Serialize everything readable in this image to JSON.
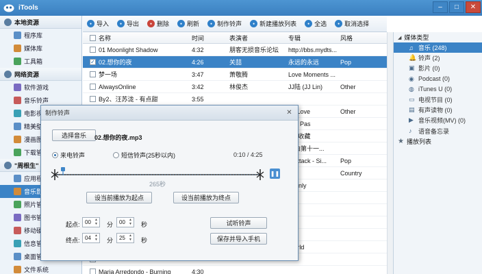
{
  "app": {
    "title": "iTools",
    "window_controls": [
      "minimize",
      "maximize",
      "close"
    ]
  },
  "sidebar": {
    "sections": [
      {
        "label": "本地资源",
        "items": [
          {
            "label": "程序库"
          },
          {
            "label": "媒体库"
          },
          {
            "label": "工具箱"
          }
        ]
      },
      {
        "label": "网络资源",
        "items": [
          {
            "label": "软件游戏"
          },
          {
            "label": "音乐铃声"
          },
          {
            "label": "电影视频"
          },
          {
            "label": "精美壁纸"
          },
          {
            "label": "漫画图书"
          },
          {
            "label": "下载管理"
          }
        ]
      },
      {
        "label": "\"周根生\"",
        "items": [
          {
            "label": "应用程序"
          },
          {
            "label": "音乐影视"
          },
          {
            "label": "照片管理"
          },
          {
            "label": "图书管理"
          },
          {
            "label": "移动硬盘"
          },
          {
            "label": "信息管理"
          },
          {
            "label": "桌面管理"
          },
          {
            "label": "文件系统"
          }
        ]
      }
    ],
    "selected": "音乐影视"
  },
  "toolbar": {
    "buttons": [
      {
        "label": "导入",
        "icon": "import-icon",
        "color": "#2f80c9"
      },
      {
        "label": "导出",
        "icon": "export-icon",
        "color": "#2f80c9"
      },
      {
        "label": "删除",
        "icon": "delete-icon",
        "color": "#c9453b"
      },
      {
        "label": "刷新",
        "icon": "refresh-icon",
        "color": "#2f80c9"
      },
      {
        "label": "制作铃声",
        "icon": "ringtone-icon",
        "color": "#2f80c9"
      },
      {
        "label": "新建播放列表",
        "icon": "playlist-icon",
        "color": "#2f80c9"
      },
      {
        "label": "全选",
        "icon": "select-all-icon",
        "color": "#2f80c9"
      },
      {
        "label": "取消选择",
        "icon": "deselect-icon",
        "color": "#2f80c9"
      }
    ]
  },
  "table": {
    "columns": [
      "名称",
      "时间",
      "表演者",
      "专辑",
      "风格"
    ],
    "rows": [
      {
        "name": "01 Moonlight Shadow",
        "time": "4:32",
        "artist": "朋客无损音乐论坛",
        "album": "http://bbs.mydts...",
        "genre": "",
        "checked": false,
        "selected": false
      },
      {
        "name": "02.想你的夜",
        "time": "4:26",
        "artist": "关喆",
        "album": "永远的永远",
        "genre": "Pop",
        "checked": true,
        "selected": true
      },
      {
        "name": "梦一场",
        "time": "3:47",
        "artist": "萧敬腾",
        "album": "Love Moments ...",
        "genre": "",
        "checked": false,
        "selected": false
      },
      {
        "name": "AlwaysOnline",
        "time": "3:42",
        "artist": "林俊杰",
        "album": "JJ陆 (JJ Lin)",
        "genre": "Other",
        "checked": false,
        "selected": false
      },
      {
        "name": "By2、汪苏泷 - 有点甜",
        "time": "3:55",
        "artist": "",
        "album": "",
        "genre": "",
        "checked": false,
        "selected": false
      },
      {
        "name": "",
        "time": "",
        "artist": "",
        "album": "ng Love",
        "genre": "Other",
        "checked": false,
        "selected": false
      },
      {
        "name": "",
        "time": "",
        "artist": "",
        "album": "mul Pas",
        "genre": "",
        "checked": false,
        "selected": false
      },
      {
        "name": "",
        "time": "",
        "artist": "",
        "album": "sen收藏",
        "genre": "",
        "checked": false,
        "selected": false
      },
      {
        "name": "",
        "time": "",
        "artist": "",
        "album": "金曲第十一...",
        "genre": "",
        "checked": false,
        "selected": false
      },
      {
        "name": "",
        "time": "",
        "artist": "",
        "album": "rt Attack - Si...",
        "genre": "Pop",
        "checked": false,
        "selected": false
      },
      {
        "name": "",
        "time": "",
        "artist": "",
        "album": "",
        "genre": "Country",
        "checked": false,
        "selected": false
      },
      {
        "name": "",
        "time": "",
        "artist": "",
        "album": "ddenly",
        "genre": "",
        "checked": false,
        "selected": false
      },
      {
        "name": "",
        "time": "",
        "artist": "",
        "album": "",
        "genre": "",
        "checked": false,
        "selected": false
      },
      {
        "name": "",
        "time": "",
        "artist": "",
        "album": "",
        "genre": "",
        "checked": false,
        "selected": false
      },
      {
        "name": "",
        "time": "",
        "artist": "",
        "album": "",
        "genre": "",
        "checked": false,
        "selected": false
      },
      {
        "name": "",
        "time": "",
        "artist": "",
        "album": "ie",
        "genre": "",
        "checked": false,
        "selected": false
      },
      {
        "name": "",
        "time": "",
        "artist": "",
        "album": "World",
        "genre": "",
        "checked": false,
        "selected": false
      },
      {
        "name": "",
        "time": "",
        "artist": "",
        "album": "",
        "genre": "",
        "checked": false,
        "selected": false
      },
      {
        "name": "Maria Arredondo - Burning",
        "time": "4:30",
        "artist": "",
        "album": "",
        "genre": "",
        "checked": false,
        "selected": false
      }
    ]
  },
  "right_panel": {
    "media_types_label": "媒体类型",
    "items": [
      {
        "label": "音乐 (248)",
        "icon": "music-icon",
        "selected": true
      },
      {
        "label": "铃声 (2)",
        "icon": "bell-icon",
        "selected": false
      },
      {
        "label": "影片 (0)",
        "icon": "film-icon",
        "selected": false
      },
      {
        "label": "Podcast (0)",
        "icon": "podcast-icon",
        "selected": false
      },
      {
        "label": "iTunes U (0)",
        "icon": "itunes-u-icon",
        "selected": false
      },
      {
        "label": "电视节目 (0)",
        "icon": "tv-icon",
        "selected": false
      },
      {
        "label": "有声读物 (0)",
        "icon": "audiobook-icon",
        "selected": false
      },
      {
        "label": "音乐视频(MV) (0)",
        "icon": "music-video-icon",
        "selected": false
      },
      {
        "label": "语音备忘录",
        "icon": "voice-memo-icon",
        "selected": false
      }
    ],
    "playlists_label": "播放列表"
  },
  "dialog": {
    "title": "制作铃声",
    "choose_music_label": "选择音乐",
    "file_name": "02.想你的夜.mp3",
    "radio_incoming": "来电铃声",
    "radio_short": "短信铃声(25秒以内)",
    "radio_selected": "incoming",
    "time_display": "0:10 / 4:25",
    "playhead_fraction": 0.04,
    "selection_length": "265秒",
    "set_start_label": "设当前播放为起点",
    "set_end_label": "设当前播放为终点",
    "start_label": "起点:",
    "end_label": "终点:",
    "start_min": "00",
    "start_sec": "00",
    "end_min": "04",
    "end_sec": "25",
    "min_unit": "分",
    "sec_unit": "秒",
    "preview_label": "试听铃声",
    "save_label": "保存并导入手机",
    "pause_icon": "pause-icon"
  }
}
